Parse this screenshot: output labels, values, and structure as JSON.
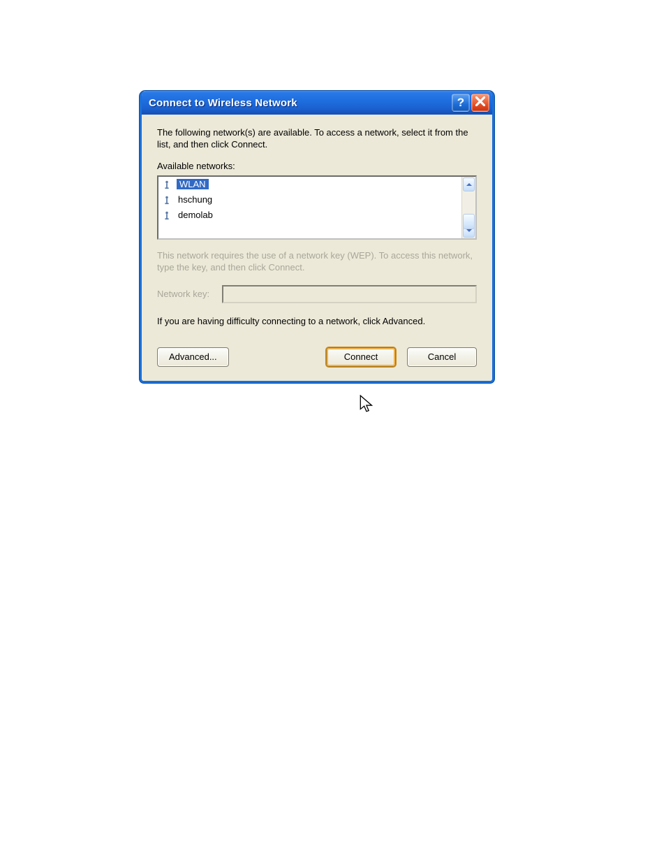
{
  "dialog": {
    "title": "Connect to Wireless Network",
    "intro": "The following network(s) are available. To access a network, select it from the list, and then click Connect.",
    "available_label": "Available networks:",
    "networks": [
      {
        "name": "WLAN",
        "selected": true
      },
      {
        "name": "hschung",
        "selected": false
      },
      {
        "name": "demolab",
        "selected": false
      }
    ],
    "wep_text": "This network requires the use of a network key (WEP). To access this network, type the key, and then click Connect.",
    "network_key_label": "Network key:",
    "network_key_value": "",
    "difficulty_text": "If you are having difficulty connecting to a network, click Advanced.",
    "buttons": {
      "advanced": "Advanced...",
      "connect": "Connect",
      "cancel": "Cancel"
    }
  }
}
